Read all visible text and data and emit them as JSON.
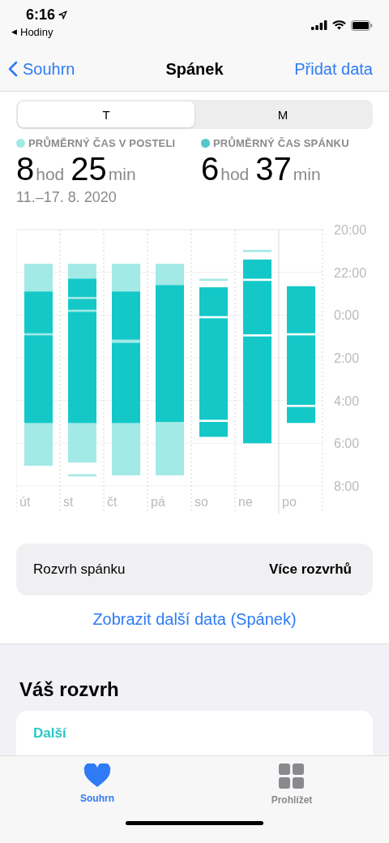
{
  "status_bar": {
    "time": "6:16",
    "back_arrow": "◀",
    "back_app": "Hodiny"
  },
  "nav": {
    "back": "Souhrn",
    "title": "Spánek",
    "action": "Přidat data"
  },
  "segments": [
    {
      "label": "T",
      "selected": true
    },
    {
      "label": "M",
      "selected": false
    }
  ],
  "stats": [
    {
      "label": "PRŮMĚRNÝ ČAS V POSTELI",
      "color": "#a3e9e6",
      "parts": [
        {
          "num": "8",
          "unit": "hod"
        },
        {
          "num": "25",
          "unit": "min"
        }
      ]
    },
    {
      "label": "PRŮMĚRNÝ ČAS SPÁNKU",
      "color": "#52c9c9",
      "parts": [
        {
          "num": "6",
          "unit": "hod"
        },
        {
          "num": "37",
          "unit": "min"
        }
      ]
    }
  ],
  "date_range": "11.–17. 8. 2020",
  "sleep_chart": {
    "day_labels": [
      "út",
      "st",
      "čt",
      "pá",
      "so",
      "ne",
      "po"
    ],
    "time_labels": [
      "20:00",
      "22:00",
      "0:00",
      "2:00",
      "4:00",
      "6:00",
      "8:00"
    ]
  },
  "schedule_row": {
    "label": "Rozvrh spánku",
    "value": "Více rozvrhů"
  },
  "more_link": "Zobrazit další data (Spánek)",
  "section": {
    "title": "Váš rozvrh",
    "card_label": "Další"
  },
  "tab_bar": [
    {
      "label": "Souhrn",
      "kind": "heart",
      "selected": true
    },
    {
      "label": "Prohlížet",
      "kind": "grid",
      "selected": false
    }
  ]
}
